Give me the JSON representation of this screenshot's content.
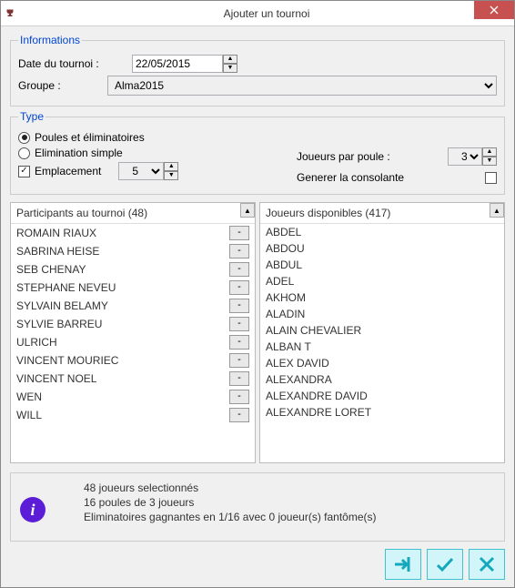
{
  "window": {
    "title": "Ajouter un tournoi"
  },
  "informations": {
    "legend": "Informations",
    "date_label": "Date du tournoi :",
    "date_value": "22/05/2015",
    "group_label": "Groupe :",
    "group_value": "Alma2015"
  },
  "type": {
    "legend": "Type",
    "option_pools": "Poules et éliminatoires",
    "option_single": "Elimination simple",
    "emplacement_label": "Emplacement",
    "emplacement_value": "5",
    "players_per_pool_label": "Joueurs par poule :",
    "players_per_pool_value": "3",
    "generate_consolation_label": "Generer la consolante"
  },
  "participants": {
    "header": "Participants au tournoi (48)",
    "count": 48,
    "items": [
      "ROMAIN RIAUX",
      "SABRINA HEISE",
      "SEB CHENAY",
      "STEPHANE NEVEU",
      "SYLVAIN  BELAMY",
      "SYLVIE BARREU",
      "ULRICH",
      "VINCENT MOURIEC",
      "VINCENT NOEL",
      "WEN",
      "WILL"
    ]
  },
  "available": {
    "header": "Joueurs disponibles (417)",
    "count": 417,
    "items": [
      "ABDEL",
      "ABDOU",
      "ABDUL",
      "ADEL",
      "AKHOM",
      "ALADIN",
      "ALAIN CHEVALIER",
      "ALBAN T",
      "ALEX DAVID",
      "ALEXANDRA",
      "ALEXANDRE DAVID",
      "ALEXANDRE LORET"
    ]
  },
  "info": {
    "line1": "48 joueurs selectionnés",
    "line2": "16 poules de 3 joueurs",
    "line3": "Eliminatoires gagnantes en 1/16 avec 0 joueur(s) fantôme(s)"
  },
  "buttons": {
    "minus": "-",
    "plus": "+"
  }
}
